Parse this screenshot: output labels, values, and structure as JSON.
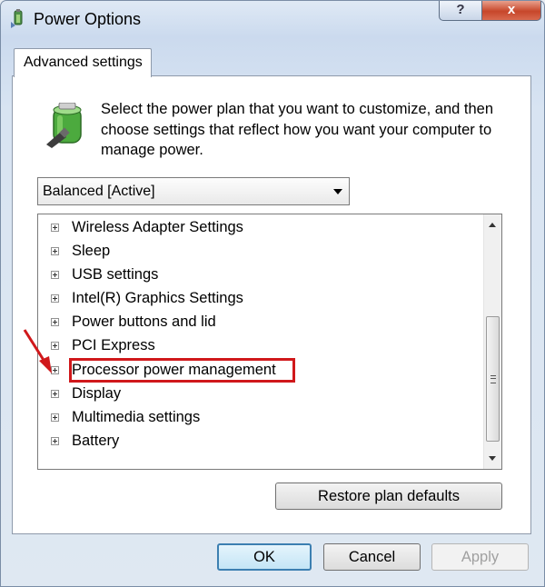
{
  "window": {
    "title": "Power Options",
    "help_label": "?",
    "close_label": "x"
  },
  "tabs": [
    {
      "label": "Advanced settings"
    }
  ],
  "description": "Select the power plan that you want to customize, and then choose settings that reflect how you want your computer to manage power.",
  "plan_select": {
    "value": "Balanced [Active]"
  },
  "settings_tree": [
    {
      "label": "Wireless Adapter Settings"
    },
    {
      "label": "Sleep"
    },
    {
      "label": "USB settings"
    },
    {
      "label": "Intel(R) Graphics Settings"
    },
    {
      "label": "Power buttons and lid"
    },
    {
      "label": "PCI Express"
    },
    {
      "label": "Processor power management",
      "highlighted": true
    },
    {
      "label": "Display"
    },
    {
      "label": "Multimedia settings"
    },
    {
      "label": "Battery"
    }
  ],
  "buttons": {
    "restore": "Restore plan defaults",
    "ok": "OK",
    "cancel": "Cancel",
    "apply": "Apply"
  },
  "colors": {
    "highlight_border": "#d0181b",
    "ok_button_border": "#3c7fb1"
  },
  "icons": {
    "title": "power-options-icon",
    "battery": "battery-plug-icon",
    "annotation": "red-arrow-icon"
  }
}
